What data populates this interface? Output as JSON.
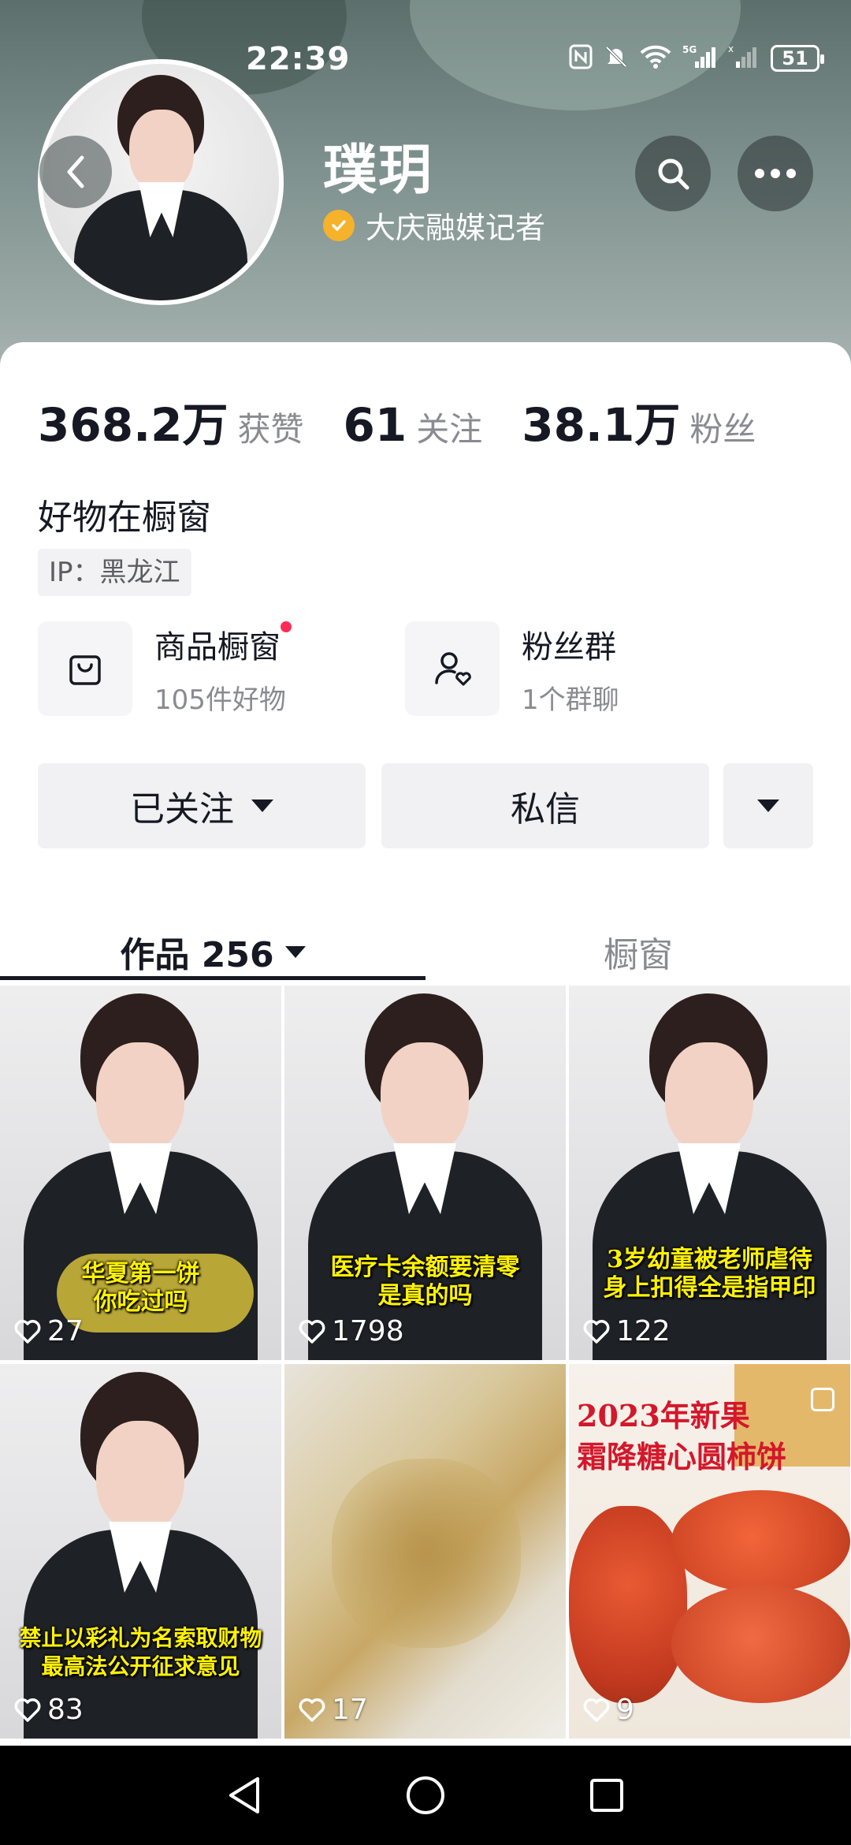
{
  "status_bar": {
    "time": "22:39",
    "battery": "51",
    "network": "5G"
  },
  "profile": {
    "name": "璞玥",
    "verification": "大庆融媒记者",
    "stats": [
      {
        "value": "368.2万",
        "label": "获赞"
      },
      {
        "value": "61",
        "label": "关注"
      },
      {
        "value": "38.1万",
        "label": "粉丝"
      }
    ],
    "bio": "好物在橱窗",
    "ip": "IP：黑龙江"
  },
  "features": [
    {
      "title": "商品橱窗",
      "subtitle": "105件好物",
      "icon": "bag-icon",
      "has_dot": true
    },
    {
      "title": "粉丝群",
      "subtitle": "1个群聊",
      "icon": "group-icon",
      "has_dot": false
    }
  ],
  "actions": {
    "follow_label": "已关注",
    "message_label": "私信"
  },
  "tabs": [
    {
      "label": "作品 256",
      "active": true
    },
    {
      "label": "橱窗",
      "active": false
    }
  ],
  "videos": [
    {
      "likes": "27",
      "caption": "华夏第一饼\n你吃过吗",
      "style": "person"
    },
    {
      "likes": "1798",
      "caption": "医疗卡余额要清零\n是真的吗",
      "style": "person"
    },
    {
      "likes": "122",
      "caption": "3岁幼童被老师虐待\n身上扣得全是指甲印",
      "style": "person"
    },
    {
      "likes": "83",
      "caption": "禁止以彩礼为名索取财物\n最高法公开征求意见",
      "style": "person"
    },
    {
      "likes": "17",
      "caption": "",
      "style": "food"
    },
    {
      "likes": "9",
      "caption": "2023年新果\n霜降糖心圆柿饼",
      "style": "persimmon"
    }
  ],
  "colors": {
    "accent_red": "#fe2c55",
    "verify_gold": "#f6b22a",
    "caption_yellow": "#fff200"
  }
}
